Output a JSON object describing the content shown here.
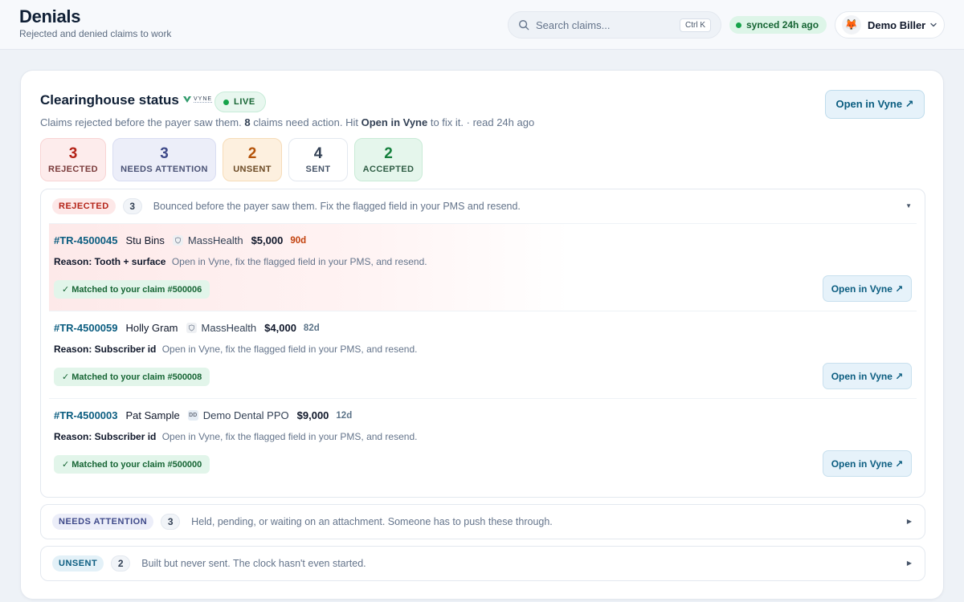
{
  "header": {
    "title": "Denials",
    "subtitle": "Rejected and denied claims to work",
    "search_placeholder": "Search claims...",
    "search_shortcut": "Ctrl K",
    "sync_status": "synced 24h ago",
    "user_name": "Demo Biller",
    "user_avatar": "🦊"
  },
  "clearinghouse": {
    "title": "Clearinghouse status",
    "logo_text": "VYNE",
    "live_label": "LIVE",
    "sub_part1": "Claims rejected before the payer saw them.",
    "sub_count": "8",
    "sub_part2": "claims need action. Hit",
    "sub_action": "Open in Vyne",
    "sub_part3": "to fix it. · read 24h ago",
    "open_button": "Open in Vyne ↗"
  },
  "stats": [
    {
      "value": "3",
      "label": "REJECTED"
    },
    {
      "value": "3",
      "label": "NEEDS ATTENTION"
    },
    {
      "value": "2",
      "label": "UNSENT"
    },
    {
      "value": "4",
      "label": "SENT"
    },
    {
      "value": "2",
      "label": "ACCEPTED"
    }
  ],
  "groups": {
    "rejected": {
      "tag": "REJECTED",
      "count": "3",
      "description": "Bounced before the payer saw them. Fix the flagged field in your PMS and resend.",
      "caret": "▼",
      "claims": [
        {
          "id": "#TR-4500045",
          "patient": "Stu Bins",
          "payer": "MassHealth",
          "amount": "$5,000",
          "age": "90d",
          "reason_label": "Reason: Tooth + surface",
          "reason_text": "Open in Vyne, fix the flagged field in your PMS, and resend.",
          "matched": "✓ Matched to your claim #500006",
          "button": "Open in Vyne ↗"
        },
        {
          "id": "#TR-4500059",
          "patient": "Holly Gram",
          "payer": "MassHealth",
          "amount": "$4,000",
          "age": "82d",
          "reason_label": "Reason: Subscriber id",
          "reason_text": "Open in Vyne, fix the flagged field in your PMS, and resend.",
          "matched": "✓ Matched to your claim #500008",
          "button": "Open in Vyne ↗"
        },
        {
          "id": "#TR-4500003",
          "patient": "Pat Sample",
          "payer": "Demo Dental PPO",
          "payer_badge": "DD",
          "amount": "$9,000",
          "age": "12d",
          "reason_label": "Reason: Subscriber id",
          "reason_text": "Open in Vyne, fix the flagged field in your PMS, and resend.",
          "matched": "✓ Matched to your claim #500000",
          "button": "Open in Vyne ↗"
        }
      ]
    },
    "needs_attention": {
      "tag": "NEEDS ATTENTION",
      "count": "3",
      "description": "Held, pending, or waiting on an attachment. Someone has to push these through.",
      "caret": "▶"
    },
    "unsent": {
      "tag": "UNSENT",
      "count": "2",
      "description": "Built but never sent. The clock hasn't even started.",
      "caret": "▶"
    }
  },
  "colors": {
    "accent": "#0b5d80",
    "rejected": "#b42318",
    "attention": "#3f4a8a",
    "unsent": "#b45309",
    "accepted": "#15803d"
  }
}
